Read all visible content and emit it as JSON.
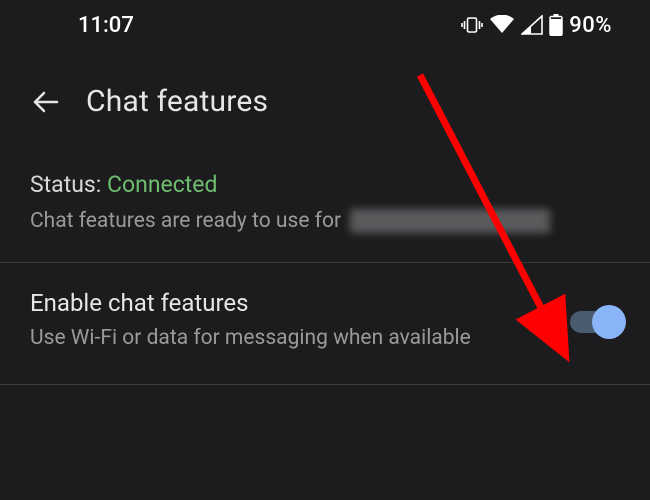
{
  "status_bar": {
    "time": "11:07",
    "battery_percent": "90%"
  },
  "header": {
    "title": "Chat features"
  },
  "status_section": {
    "label": "Status: ",
    "value": "Connected",
    "description": "Chat features are ready to use for"
  },
  "enable_row": {
    "title": "Enable chat features",
    "description": "Use Wi-Fi or data for messaging when available",
    "toggle_on": true
  },
  "colors": {
    "background": "#1c1c1e",
    "text_primary": "#e6e6e6",
    "text_secondary": "#9a9a9c",
    "connected": "#6fbe6f",
    "toggle_knob": "#8ab4f8",
    "annotation": "#ff0000"
  }
}
